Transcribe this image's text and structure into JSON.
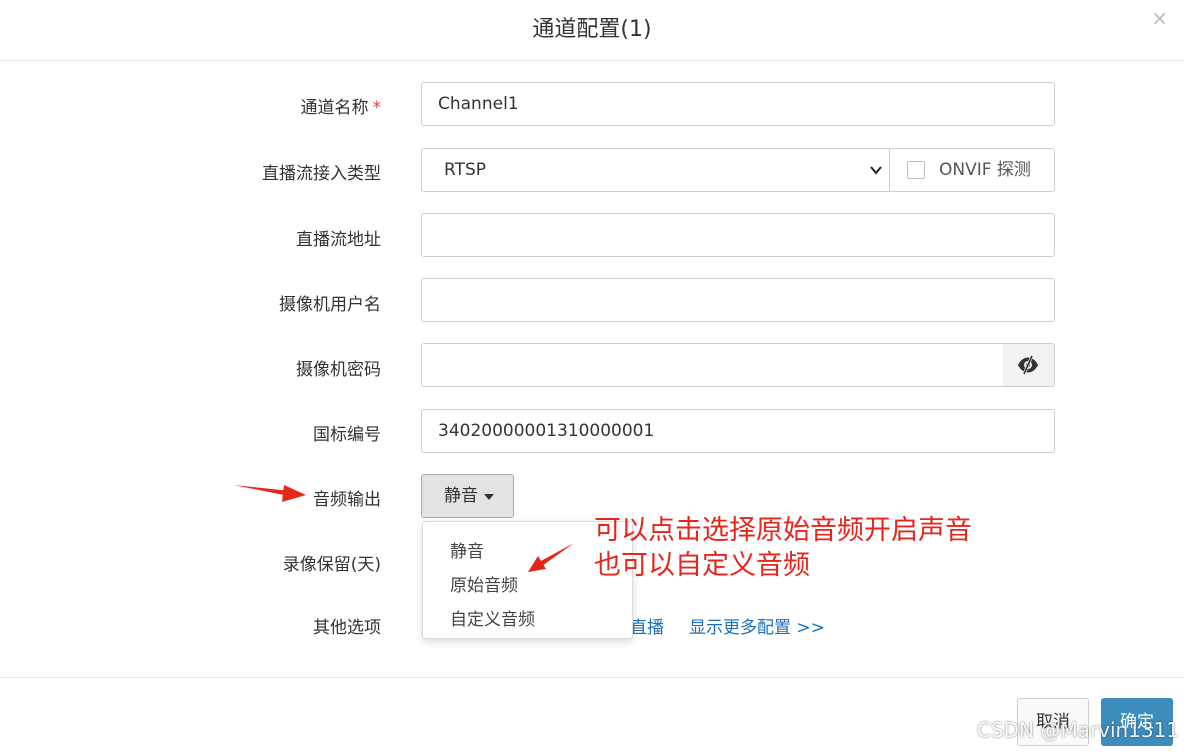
{
  "dialog": {
    "title": "通道配置(1)",
    "close_glyph": "×"
  },
  "form": {
    "channel_name": {
      "label": "通道名称",
      "required_mark": "*",
      "value": "Channel1"
    },
    "stream_type": {
      "label": "直播流接入类型",
      "selected": "RTSP",
      "onvif_label": "ONVIF 探测",
      "onvif_checked": false
    },
    "stream_url": {
      "label": "直播流地址",
      "value": ""
    },
    "camera_user": {
      "label": "摄像机用户名",
      "value": ""
    },
    "camera_password": {
      "label": "摄像机密码",
      "value": "",
      "toggle_icon": "eye-slash-icon"
    },
    "gb_id": {
      "label": "国标编号",
      "value": "34020000001310000001"
    },
    "audio_output": {
      "label": "音频输出",
      "selected": "静音",
      "options": [
        "静音",
        "原始音频",
        "自定义音频"
      ]
    },
    "record_retention": {
      "label": "录像保留(天)"
    },
    "other_options": {
      "label": "其他选项",
      "link_partial": "直播",
      "link_more": "显示更多配置 >>"
    }
  },
  "footer": {
    "cancel_label": "取消",
    "ok_label": "确定"
  },
  "annotation": {
    "line1": "可以点击选择原始音频开启声音",
    "line2": "也可以自定义音频",
    "color": "#e4261c"
  },
  "watermark": "CSDN @Marvin1311",
  "colors": {
    "primary": "#3c8dbc",
    "link": "#1b6fb8",
    "required": "#e4393c"
  }
}
